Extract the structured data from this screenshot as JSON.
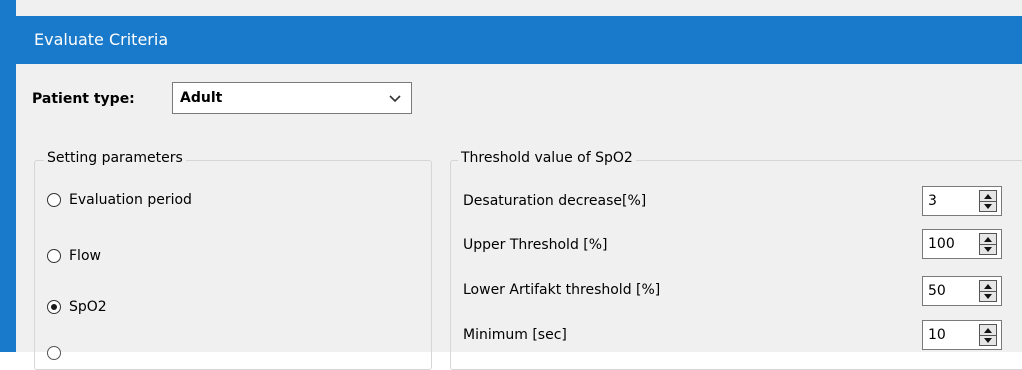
{
  "window": {
    "title": "Evaluate Criteria"
  },
  "patient": {
    "label": "Patient type:",
    "selected": "Adult"
  },
  "setting_parameters": {
    "title": "Setting parameters",
    "options": [
      {
        "label": "Evaluation period",
        "checked": false
      },
      {
        "label": "Flow",
        "checked": false
      },
      {
        "label": "SpO2",
        "checked": true
      }
    ]
  },
  "threshold": {
    "title": "Threshold value of SpO2",
    "params": [
      {
        "label": "Desaturation decrease[%]",
        "value": "3"
      },
      {
        "label": "Upper Threshold [%]",
        "value": "100"
      },
      {
        "label": "Lower Artifakt threshold [%]",
        "value": "50"
      },
      {
        "label": "Minimum [sec]",
        "value": "10"
      }
    ]
  },
  "colors": {
    "titlebar": "#1979ca",
    "background": "#f0f0f0"
  }
}
